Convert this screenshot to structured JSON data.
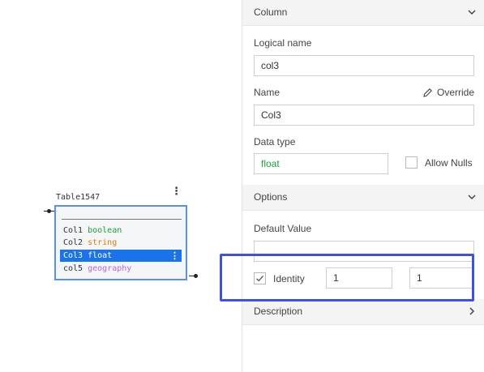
{
  "diagram": {
    "table_name": "Table1547",
    "menu_icon": "⋮",
    "columns": [
      {
        "name": "Col1",
        "type": "boolean",
        "type_color": "#1e9e3b",
        "selected": false
      },
      {
        "name": "Col2",
        "type": "string",
        "type_color": "#e07b14",
        "selected": false
      },
      {
        "name": "Col3",
        "type": "float",
        "type_color": "#ffffff",
        "selected": true
      },
      {
        "name": "col5",
        "type": "geography",
        "type_color": "#b56ad8",
        "selected": false
      }
    ]
  },
  "panel": {
    "column_section": {
      "label": "Column",
      "expanded": true
    },
    "logical_name": {
      "label": "Logical name",
      "value": "col3"
    },
    "name": {
      "label": "Name",
      "value": "Col3",
      "override_label": "Override"
    },
    "data_type": {
      "label": "Data type",
      "value": "float",
      "value_color": "#1e9e3b"
    },
    "allow_nulls": {
      "label": "Allow Nulls",
      "checked": false
    },
    "options_section": {
      "label": "Options",
      "expanded": true
    },
    "default_value": {
      "label": "Default Value",
      "value": ""
    },
    "identity": {
      "label": "Identity",
      "checked": true,
      "seed": "1",
      "increment": "1"
    },
    "description_section": {
      "label": "Description",
      "expanded": false
    }
  },
  "colors": {
    "selection_blue": "#1a73e8",
    "table_border": "#5b8ee6",
    "highlight_box": "#3d52e0"
  }
}
